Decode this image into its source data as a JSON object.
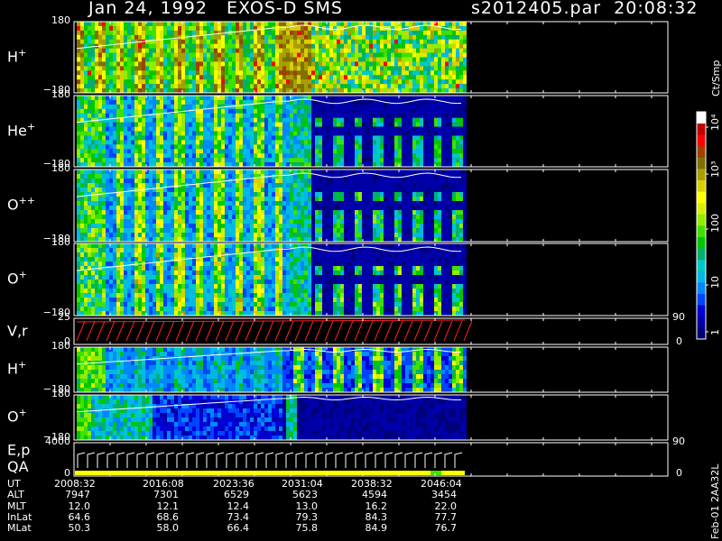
{
  "header": {
    "title": "Jan 24, 1992   EXOS-D SMS",
    "file_time": "s2012405.par  20:08:32"
  },
  "panels": [
    {
      "label": "H",
      "sup": "+",
      "ymin": "−180",
      "ymax": "180"
    },
    {
      "label": "He",
      "sup": "+",
      "ymin": "−180",
      "ymax": "180"
    },
    {
      "label": "O",
      "sup": "++",
      "ymin": "−180",
      "ymax": "180"
    },
    {
      "label": "O",
      "sup": "+",
      "ymin": "−180",
      "ymax": "180"
    },
    {
      "label": "V,r",
      "sup": "",
      "ymin": "0",
      "ymax": "25",
      "rmin": "0",
      "rmax": "90"
    },
    {
      "label": "H",
      "sup": "+",
      "ymin": "−180",
      "ymax": "180"
    },
    {
      "label": "O",
      "sup": "+",
      "ymin": "−180",
      "ymax": "180"
    },
    {
      "label": "E,p",
      "label2": "QA",
      "sup": "",
      "ymin": "0",
      "ymax": "4000",
      "rmin": "0",
      "rmax": "90"
    }
  ],
  "colorbar": {
    "units": "Ct/Smp",
    "ticks": [
      "1",
      "10",
      "100",
      "10³",
      "10⁴"
    ],
    "colors": [
      "#00007a",
      "#0000a8",
      "#0000d8",
      "#0044ff",
      "#0088ff",
      "#00b8e8",
      "#00c8c8",
      "#00b070",
      "#00c800",
      "#40e000",
      "#90ee00",
      "#d8f000",
      "#ffff00",
      "#d8d000",
      "#a8a000",
      "#807000",
      "#a04000",
      "#ff0000",
      "#c00000",
      "#ffffff"
    ]
  },
  "footer_note": "Feb-01 2AA32L",
  "ephemeris": {
    "rows": [
      {
        "name": "UT",
        "values": [
          "2008:32",
          "2016:08",
          "2023:36",
          "2031:04",
          "2038:32",
          "2046:04"
        ]
      },
      {
        "name": "ALT",
        "values": [
          "7947",
          "7301",
          "6529",
          "5623",
          "4594",
          "3454"
        ]
      },
      {
        "name": "MLT",
        "values": [
          "12.0",
          "12.1",
          "12.4",
          "13.0",
          "16.2",
          "22.0"
        ]
      },
      {
        "name": "InLat",
        "values": [
          "64.6",
          "68.6",
          "73.4",
          "79.3",
          "84.3",
          "77.7"
        ]
      },
      {
        "name": "MLat",
        "values": [
          "50.3",
          "58.0",
          "66.4",
          "75.8",
          "84.9",
          "76.7"
        ]
      }
    ]
  },
  "chart_data": {
    "type": "heatmap",
    "title": "Jan 24, 1992   EXOS-D SMS",
    "x_ticks_ut": [
      "2008:32",
      "2016:08",
      "2023:36",
      "2031:04",
      "2038:32",
      "2046:04"
    ],
    "data_end_ut": "2048:00",
    "spectrogram_panels": [
      {
        "species": "H+",
        "ylim": [
          -180,
          180
        ]
      },
      {
        "species": "He+",
        "ylim": [
          -180,
          180
        ]
      },
      {
        "species": "O++",
        "ylim": [
          -180,
          180
        ]
      },
      {
        "species": "O+",
        "ylim": [
          -180,
          180
        ]
      },
      {
        "species": "H+",
        "ylim": [
          -180,
          180
        ]
      },
      {
        "species": "O+",
        "ylim": [
          -180,
          180
        ]
      }
    ],
    "line_panels": [
      {
        "label": "V,r",
        "ylim": [
          0,
          25
        ],
        "right_ylim": [
          0,
          90
        ]
      },
      {
        "label": "E,p",
        "ylim": [
          0,
          4000
        ],
        "right_ylim": [
          0,
          90
        ]
      }
    ],
    "color_scale": {
      "units": "Ct/Smp",
      "log": true,
      "range": [
        1,
        10000
      ]
    }
  }
}
